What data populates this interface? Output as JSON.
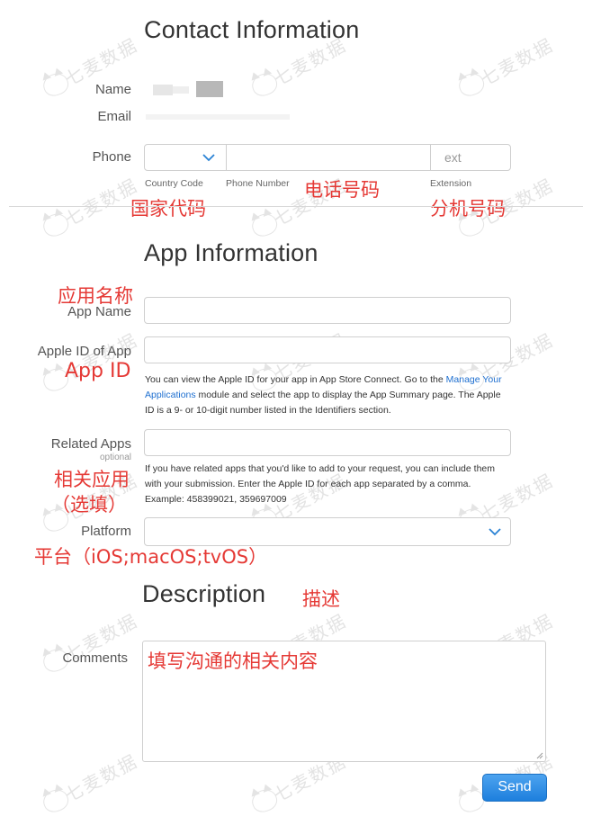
{
  "contact": {
    "title": "Contact Information",
    "name_label": "Name",
    "email_label": "Email",
    "phone_label": "Phone",
    "ext_placeholder": "ext",
    "country_code_note": "Country Code",
    "phone_number_note": "Phone Number",
    "extension_note": "Extension",
    "cn_country_code": "国家代码",
    "cn_phone_number": "电话号码",
    "cn_extension": "分机号码"
  },
  "app": {
    "title": "App Information",
    "cn_app_name": "应用名称",
    "app_name_label": "App Name",
    "apple_id_label": "Apple ID of App",
    "cn_app_id": "App ID",
    "apple_id_help_1": "You can view the Apple ID for your app in App Store Connect. Go to the ",
    "apple_id_help_link": "Manage Your Applications",
    "apple_id_help_2": " module and select the app to display the App Summary page. The Apple ID is a 9- or 10-digit number listed in the Identifiers section.",
    "related_label": "Related Apps",
    "related_optional": "optional",
    "related_help": "If you have related apps that you'd like to add to your request, you can include them with your submission. Enter the Apple ID for each app separated by a comma. Example: 458399021, 359697009",
    "cn_related_1": "相关应用",
    "cn_related_2": "（选填）",
    "platform_label": "Platform",
    "cn_platform": "平台（iOS;macOS;tvOS）"
  },
  "description": {
    "title": "Description",
    "cn_title": "描述",
    "comments_label": "Comments",
    "cn_comments": "填写沟通的相关内容",
    "send_label": "Send"
  },
  "watermark": {
    "text": "七麦数据"
  },
  "colors": {
    "annotation": "#e53935",
    "link": "#1e6fd0",
    "accent": "#1d7fdd"
  }
}
